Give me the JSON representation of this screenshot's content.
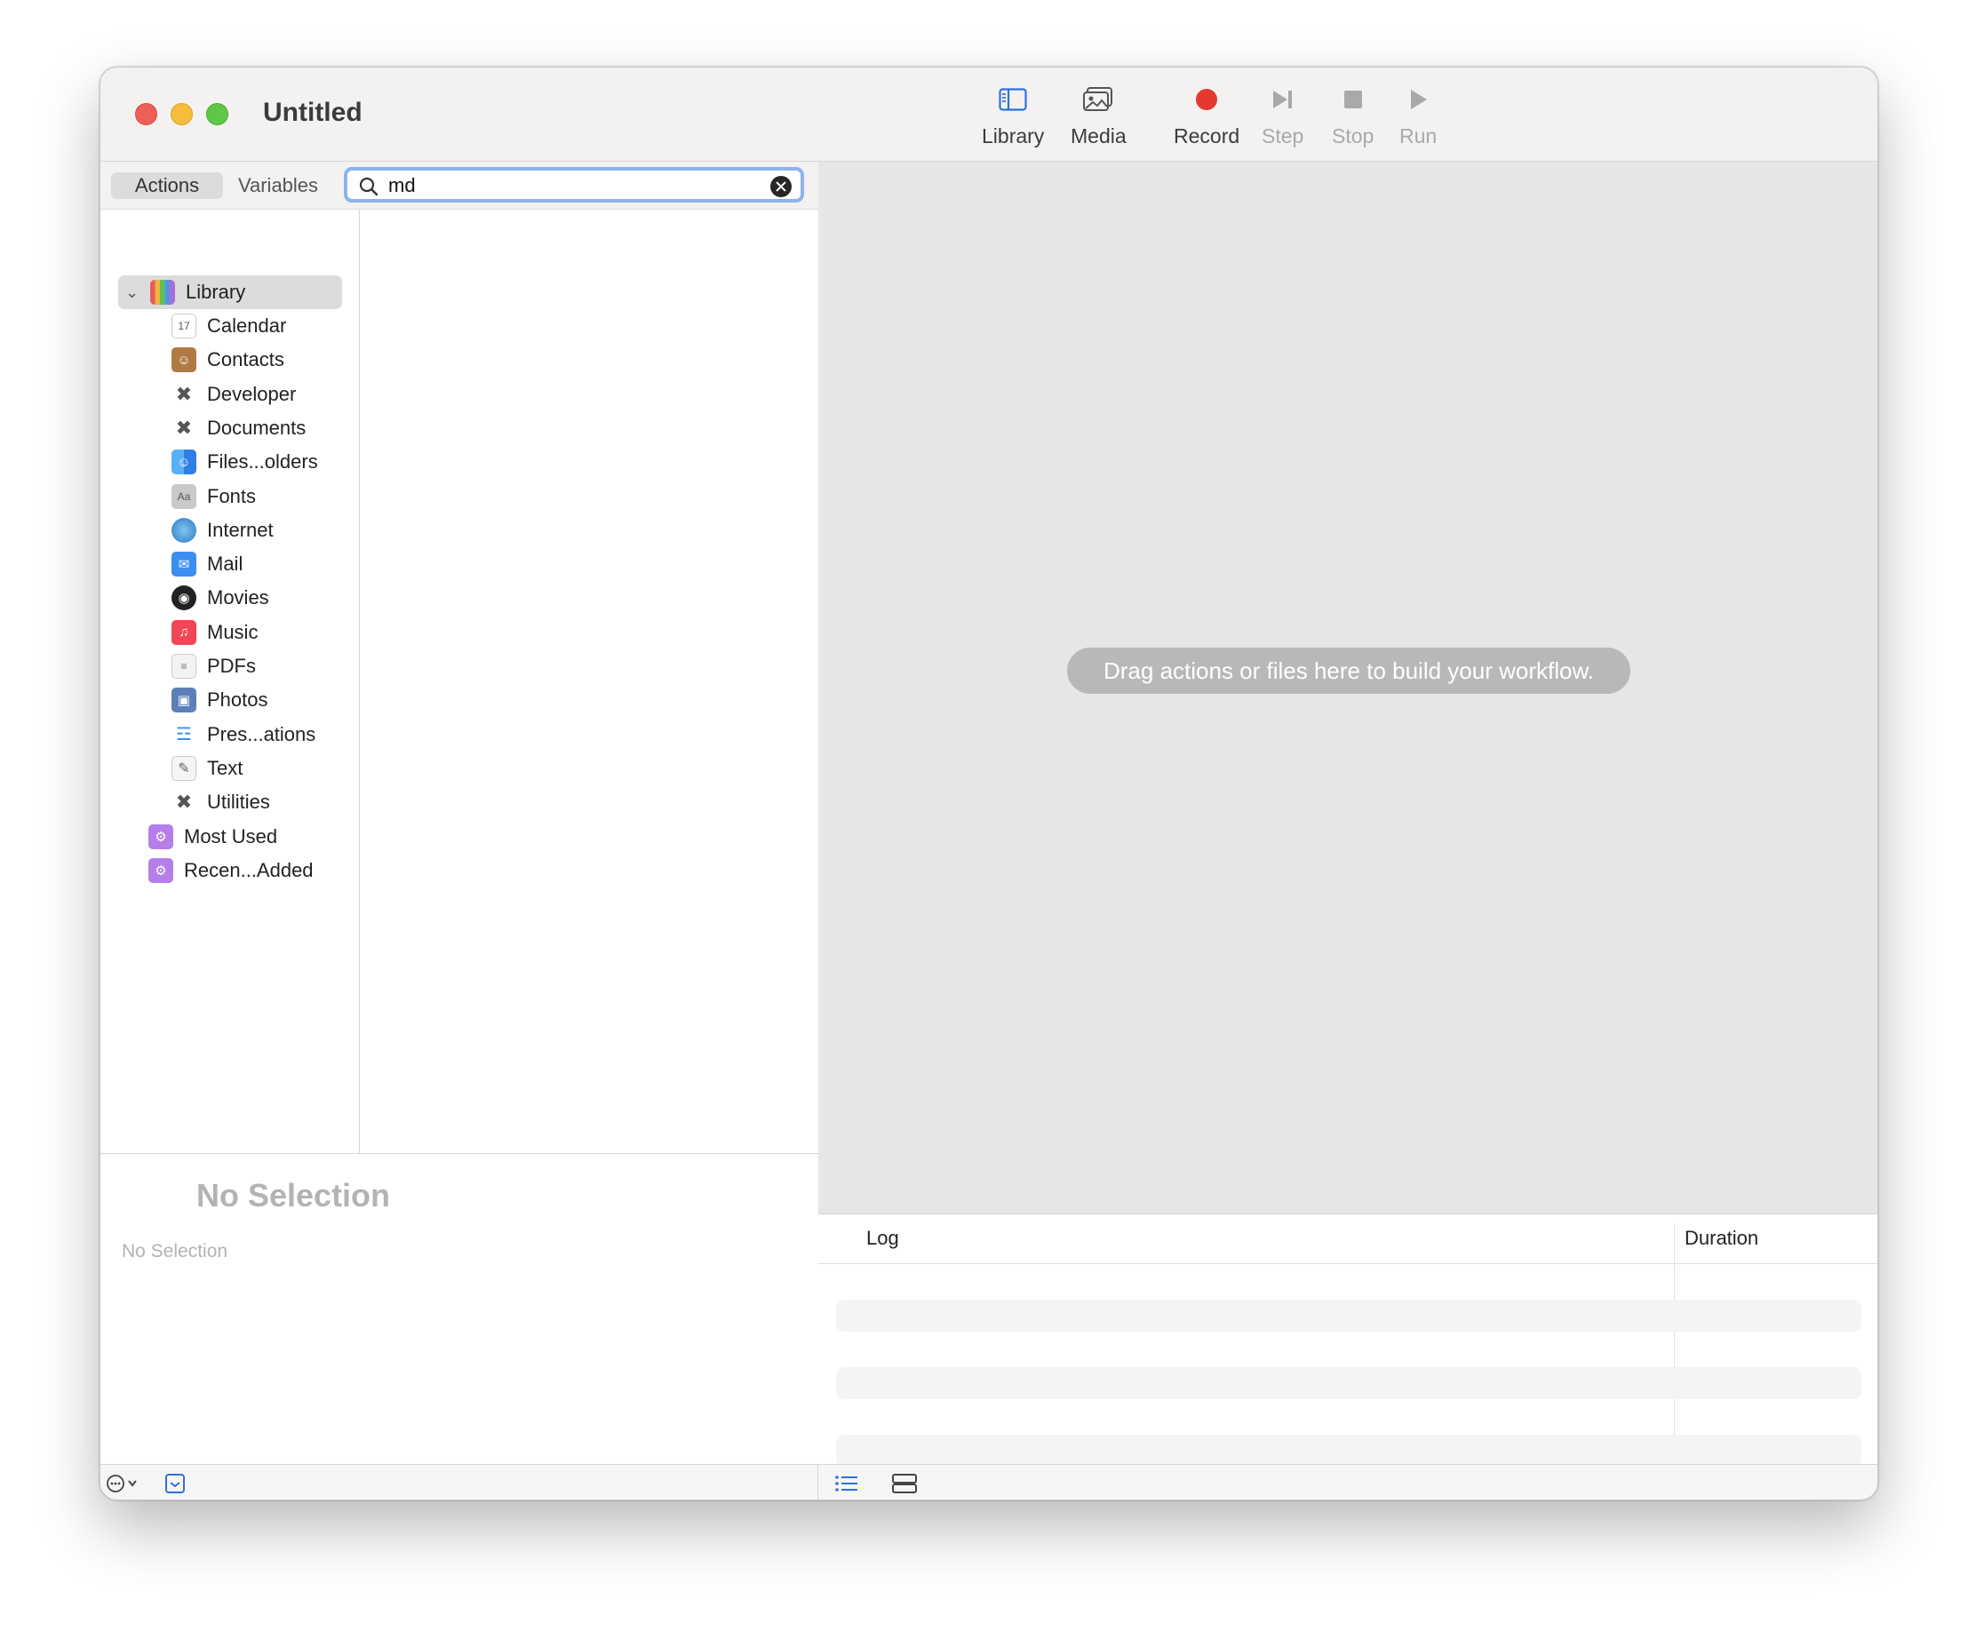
{
  "window": {
    "title": "Untitled"
  },
  "toolbar": {
    "library": "Library",
    "media": "Media",
    "record": "Record",
    "step": "Step",
    "stop": "Stop",
    "run": "Run",
    "record_color": "#e5392f"
  },
  "tabs": {
    "actions": "Actions",
    "variables": "Variables"
  },
  "search": {
    "value": "md"
  },
  "library": {
    "root": "Library",
    "categories": [
      {
        "label": "Calendar",
        "icon": "calendar-icon"
      },
      {
        "label": "Contacts",
        "icon": "contacts-icon"
      },
      {
        "label": "Developer",
        "icon": "developer-icon"
      },
      {
        "label": "Documents",
        "icon": "documents-icon"
      },
      {
        "label": "Files...olders",
        "icon": "finder-icon"
      },
      {
        "label": "Fonts",
        "icon": "fonts-icon"
      },
      {
        "label": "Internet",
        "icon": "globe-icon"
      },
      {
        "label": "Mail",
        "icon": "mail-icon"
      },
      {
        "label": "Movies",
        "icon": "movies-icon"
      },
      {
        "label": "Music",
        "icon": "music-icon"
      },
      {
        "label": "PDFs",
        "icon": "pdf-icon"
      },
      {
        "label": "Photos",
        "icon": "photos-icon"
      },
      {
        "label": "Pres...ations",
        "icon": "presentations-icon"
      },
      {
        "label": "Text",
        "icon": "text-icon"
      },
      {
        "label": "Utilities",
        "icon": "utilities-icon"
      }
    ],
    "smart_folders": [
      {
        "label": "Most Used",
        "icon": "smart-folder-icon"
      },
      {
        "label": "Recen...Added",
        "icon": "smart-folder-icon"
      }
    ]
  },
  "description": {
    "title": "No Selection",
    "subtitle": "No Selection"
  },
  "workflow": {
    "hint": "Drag actions or files here to build your workflow."
  },
  "log": {
    "col_log": "Log",
    "col_duration": "Duration"
  }
}
